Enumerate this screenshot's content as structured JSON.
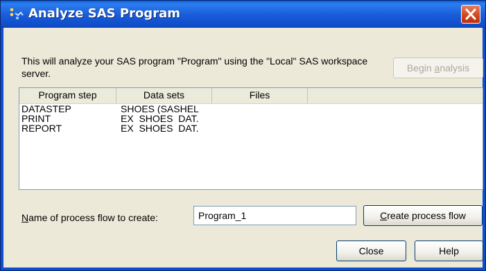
{
  "window": {
    "title": "Analyze SAS Program",
    "icon": "sas-analyze-icon",
    "close_icon": "close-icon"
  },
  "description": "This will analyze your SAS program \"Program\" using the \"Local\" SAS workspace server.",
  "buttons": {
    "begin_analysis_pre": "Begin ",
    "begin_analysis_accel": "a",
    "begin_analysis_post": "nalysis",
    "create_flow_accel": "C",
    "create_flow_post": "reate process flow",
    "close": "Close",
    "help": "Help"
  },
  "table": {
    "columns": [
      "Program step",
      "Data sets",
      "Files"
    ],
    "rows": [
      [
        "DATASTEP",
        "SHOES (SASHEL",
        ""
      ],
      [
        "PRINT",
        "EX_SHOES_DAT.",
        ""
      ],
      [
        "REPORT",
        "EX_SHOES_DAT.",
        ""
      ]
    ]
  },
  "flow": {
    "label_accel": "N",
    "label_post": "ame of process flow to create:",
    "value": "Program_1"
  },
  "colors": {
    "titlebar": "#1a5cd8",
    "dialog_bg": "#ece9d8",
    "close_button": "#d1441b"
  }
}
